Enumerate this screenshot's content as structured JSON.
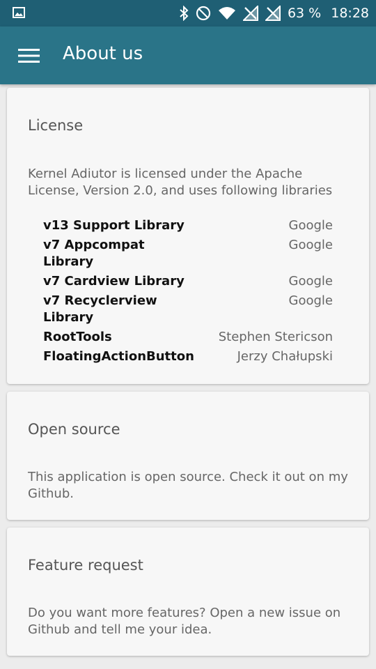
{
  "status_bar": {
    "battery": "63 %",
    "time": "18:28"
  },
  "app_bar": {
    "title": "About us"
  },
  "license_card": {
    "title": "License",
    "body": "Kernel Adiutor is licensed under the Apache License, Version 2.0, and uses following libraries",
    "libraries": [
      {
        "name": "v13 Support Library",
        "author": "Google"
      },
      {
        "name": "v7 Appcompat Library",
        "author": "Google"
      },
      {
        "name": "v7 Cardview Library",
        "author": "Google"
      },
      {
        "name": "v7 Recyclerview Library",
        "author": "Google"
      },
      {
        "name": "RootTools",
        "author": "Stephen Stericson"
      },
      {
        "name": "FloatingActionButton",
        "author": "Jerzy Chałupski"
      }
    ]
  },
  "open_source_card": {
    "title": "Open source",
    "body": "This application is open source. Check it out on my Github."
  },
  "feature_request_card": {
    "title": "Feature request",
    "body": "Do you want more features? Open a new issue on Github and tell me your idea."
  }
}
